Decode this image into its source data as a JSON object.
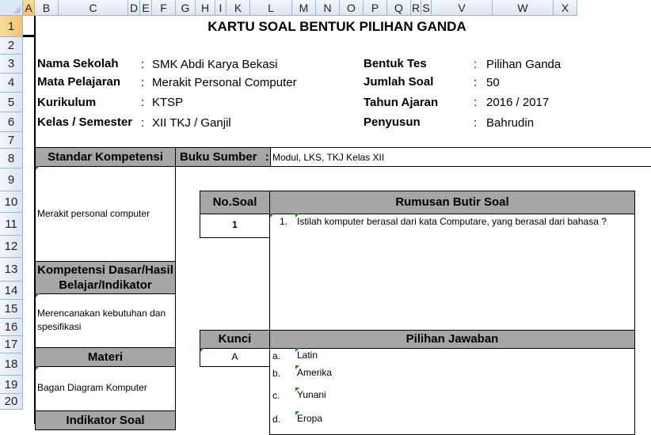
{
  "columns": [
    "A",
    "B",
    "C",
    "D",
    "E",
    "F",
    "G",
    "H",
    "I",
    "K",
    "L",
    "M",
    "N",
    "O",
    "P",
    "Q",
    "R",
    "S",
    "V",
    "W",
    "X"
  ],
  "rows": [
    "1",
    "2",
    "3",
    "4",
    "5",
    "6",
    "7",
    "8",
    "9",
    "10",
    "11",
    "12",
    "13",
    "14",
    "15",
    "16",
    "17",
    "18",
    "19",
    "20"
  ],
  "selected_cell": "A1",
  "title": "KARTU SOAL BENTUK PILIHAN GANDA",
  "info": {
    "nama_sekolah_label": "Nama Sekolah",
    "nama_sekolah": "SMK Abdi Karya Bekasi",
    "mapel_label": "Mata Pelajaran",
    "mapel": "Merakit Personal Computer",
    "kurikulum_label": "Kurikulum",
    "kurikulum": "KTSP",
    "kelas_label": "Kelas / Semester",
    "kelas": "XII TKJ / Ganjil",
    "bentuk_label": "Bentuk Tes",
    "bentuk": "Pilihan Ganda",
    "jumlah_label": "Jumlah Soal",
    "jumlah": "50",
    "tahun_label": "Tahun Ajaran",
    "tahun": "2016 / 2017",
    "penyusun_label": "Penyusun",
    "penyusun": "Bahrudin",
    "sep": ":"
  },
  "standar_kompetensi": {
    "header": "Standar Kompetensi",
    "text": "Merakit personal computer"
  },
  "buku_sumber": {
    "label": "Buku Sumber",
    "sep": ":",
    "value": "Modul, LKS, TKJ Kelas XII"
  },
  "kompetensi_dasar": {
    "header_line1": "Kompetensi Dasar/Hasil",
    "header_line2": "Belajar/Indikator",
    "text_line1": "Merencanakan kebutuhan dan",
    "text_line2": "spesifikasi"
  },
  "materi": {
    "header": "Materi",
    "text": "Bagan Diagram Komputer"
  },
  "indikator": {
    "header": "Indikator Soal"
  },
  "no_soal": {
    "header": "No.Soal",
    "value": "1"
  },
  "rumusan": {
    "header": "Rumusan Butir Soal",
    "number": "1.",
    "question": "Istilah komputer berasal dari kata Computare, yang berasal dari bahasa ?"
  },
  "kunci": {
    "header": "Kunci",
    "value": "A"
  },
  "pilihan": {
    "header": "Pilihan Jawaban",
    "options": [
      {
        "key": "a.",
        "text": "Latin"
      },
      {
        "key": "b.",
        "text": "Amerika"
      },
      {
        "key": "c.",
        "text": "Yunani"
      },
      {
        "key": "d.",
        "text": "Eropa"
      }
    ]
  }
}
